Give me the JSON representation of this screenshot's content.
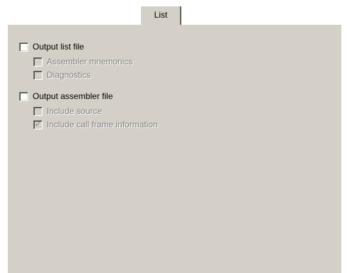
{
  "tabs": [
    {
      "label": "List",
      "selected": true
    }
  ],
  "options": {
    "output_list_file": {
      "label": "Output list file",
      "checked": false
    },
    "assembler_mnemonics": {
      "label": "Assembler mnemonics",
      "checked": false,
      "enabled": false
    },
    "diagnostics": {
      "label": "Diagnostics",
      "checked": false,
      "enabled": false
    },
    "output_assembler_file": {
      "label": "Output assembler file",
      "checked": false
    },
    "include_source": {
      "label": "Include source",
      "checked": false,
      "enabled": false
    },
    "include_call_frame": {
      "label": "Include call frame information",
      "checked": true,
      "enabled": false
    }
  },
  "colors": {
    "face": "#d4d0c8",
    "disabled_text": "#808080",
    "highlight": "#ffffff"
  }
}
